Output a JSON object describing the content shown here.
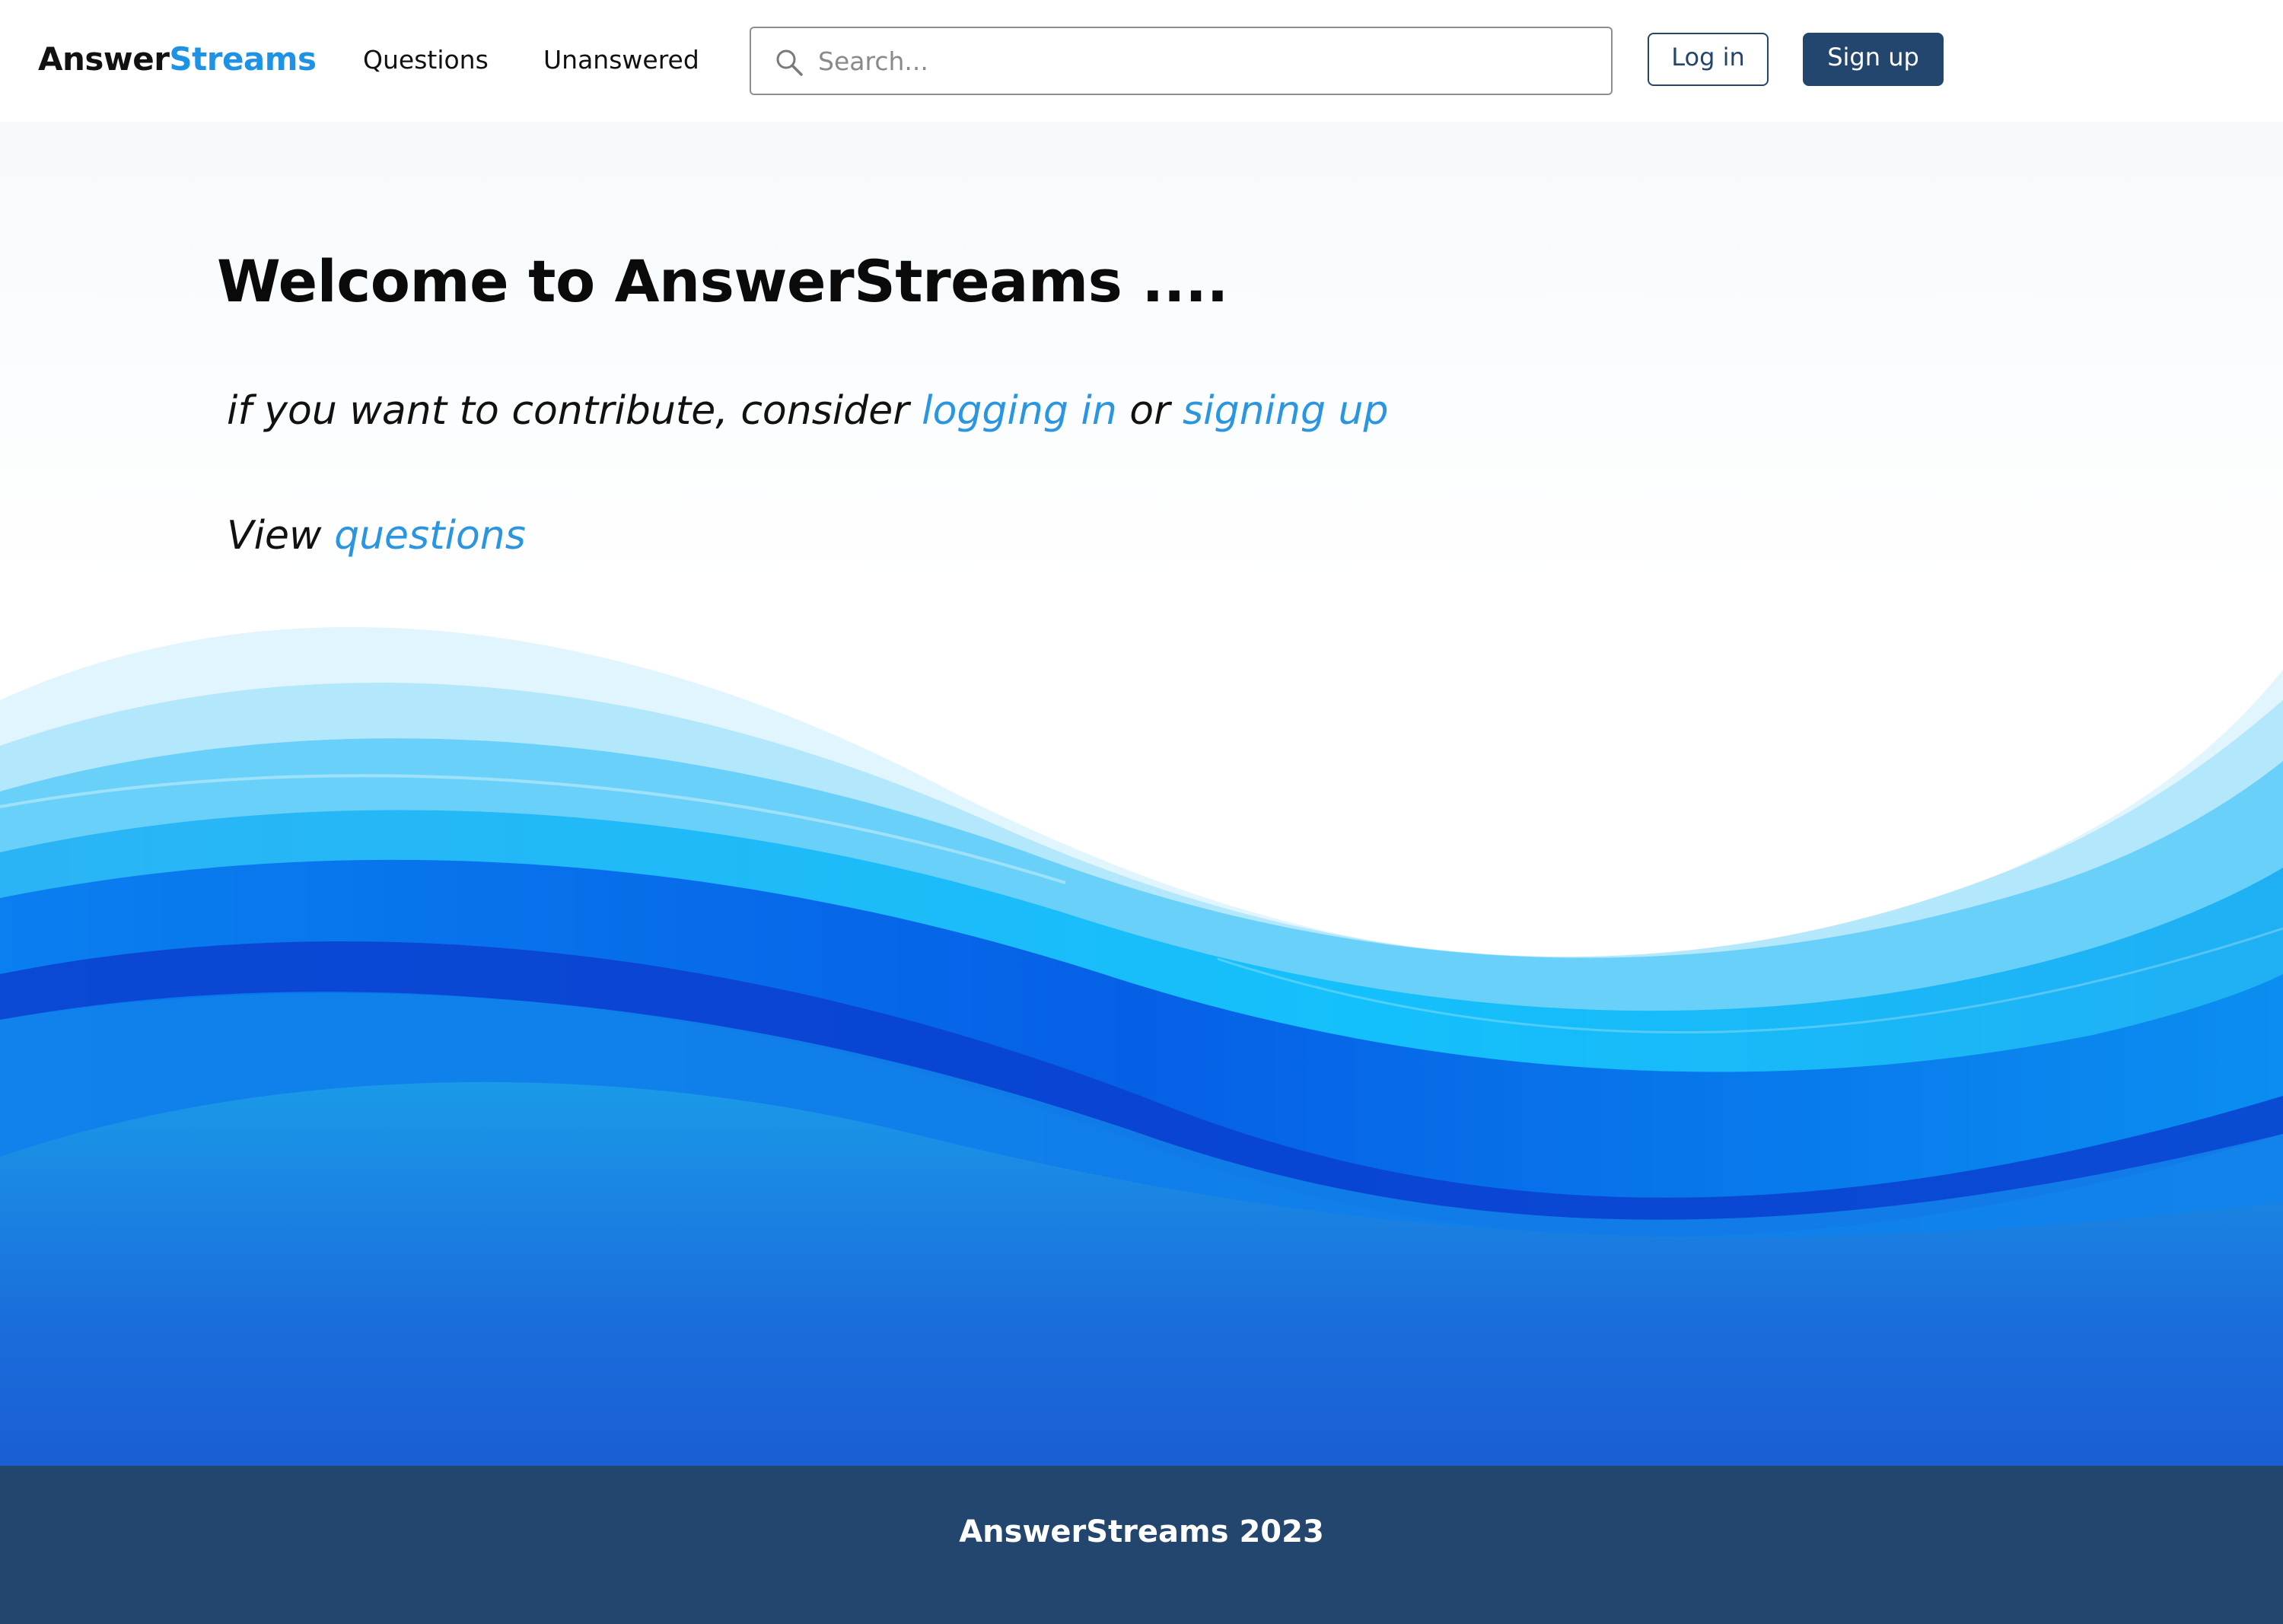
{
  "brand": {
    "part1": "Answer",
    "part2": "Streams"
  },
  "nav": {
    "questions": "Questions",
    "unanswered": "Unanswered"
  },
  "search": {
    "placeholder": "Search..."
  },
  "auth": {
    "login": "Log in",
    "signup": "Sign up"
  },
  "hero": {
    "title": "Welcome to AnswerStreams ....",
    "contribute_prefix": "if you want to contribute, consider ",
    "login_link": "logging in",
    "or_text": " or ",
    "signup_link": "signing up",
    "view_prefix": "View ",
    "questions_link": "questions"
  },
  "footer": {
    "text": "AnswerStreams 2023"
  },
  "colors": {
    "accent": "#1e93e6",
    "navy": "#22466e",
    "link": "#2a95e0"
  },
  "icons": {
    "search": "search-icon"
  }
}
